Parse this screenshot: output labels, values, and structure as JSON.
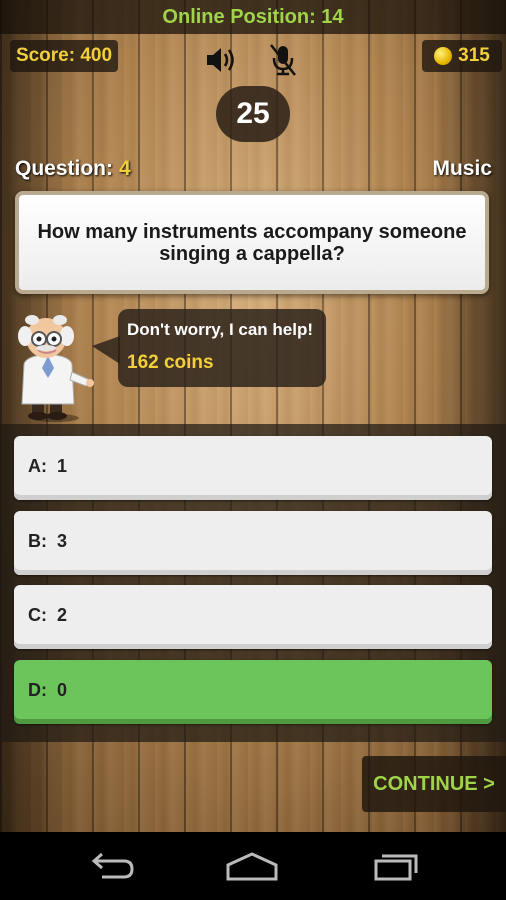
{
  "header": {
    "online_position": "Online Position: 14"
  },
  "stats": {
    "score": "Score: 400",
    "coins": "315"
  },
  "timer": "25",
  "question": {
    "label": "Question:",
    "number": "4",
    "category": "Music",
    "text": "How many instruments accompany someone singing a cappella?"
  },
  "helper": {
    "message": "Don't worry, I can help!",
    "cost": "162 coins"
  },
  "answers": [
    {
      "letter": "A:",
      "text": "1"
    },
    {
      "letter": "B:",
      "text": "3"
    },
    {
      "letter": "C:",
      "text": "2"
    },
    {
      "letter": "D:",
      "text": "0"
    }
  ],
  "continue_label": "CONTINUE >",
  "colors": {
    "accent_green": "#9fd44a",
    "gold": "#f3cf3a",
    "correct": "#6cc55a"
  },
  "icons": [
    "sound-on-icon",
    "mic-muted-icon",
    "coin-icon",
    "back-icon",
    "home-icon",
    "recent-apps-icon"
  ]
}
